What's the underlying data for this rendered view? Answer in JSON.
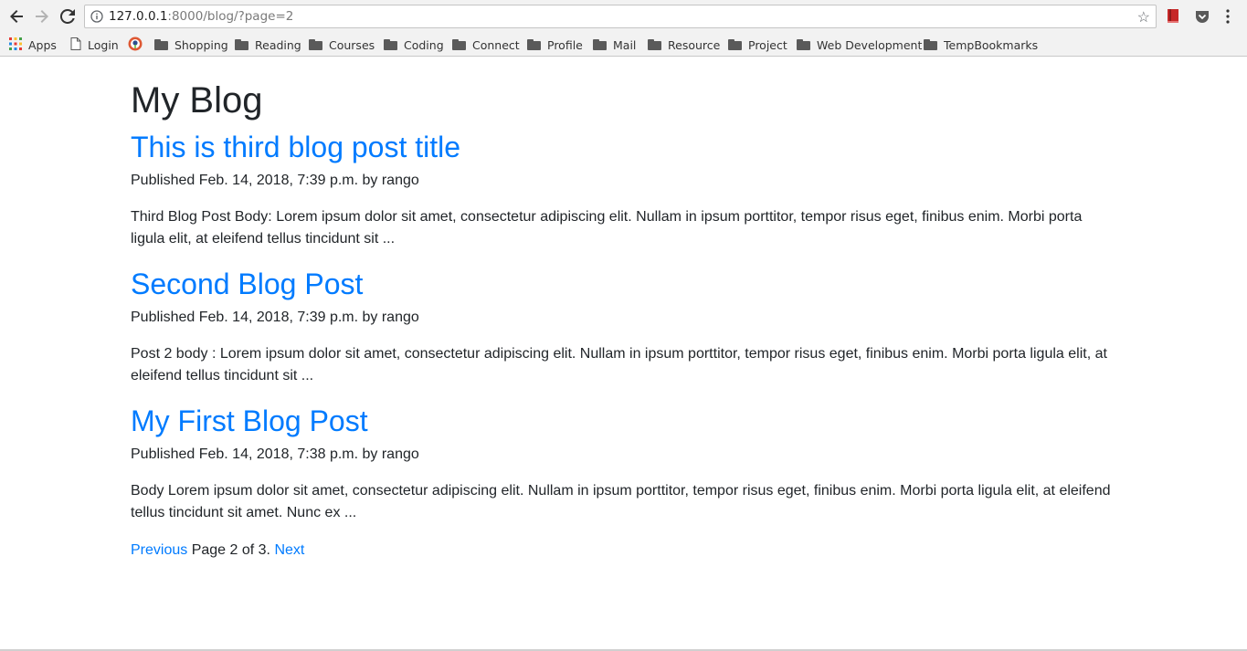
{
  "browser": {
    "url_host": "127.0.0.1",
    "url_path": ":8000/blog/?page=2",
    "bookmarks": [
      "Apps",
      "Login",
      "Shopping",
      "Reading",
      "Courses",
      "Coding",
      "Connect",
      "Profile",
      "Mail",
      "Resource",
      "Project",
      "Web Development",
      "TempBookmarks"
    ]
  },
  "page": {
    "title": "My Blog",
    "posts": [
      {
        "title": "This is third blog post title",
        "meta": "Published Feb. 14, 2018, 7:39 p.m. by rango",
        "body": "Third Blog Post Body: Lorem ipsum dolor sit amet, consectetur adipiscing elit. Nullam in ipsum porttitor, tempor risus eget, finibus enim. Morbi porta ligula elit, at eleifend tellus tincidunt sit ..."
      },
      {
        "title": "Second Blog Post",
        "meta": "Published Feb. 14, 2018, 7:39 p.m. by rango",
        "body": "Post 2 body : Lorem ipsum dolor sit amet, consectetur adipiscing elit. Nullam in ipsum porttitor, tempor risus eget, finibus enim. Morbi porta ligula elit, at eleifend tellus tincidunt sit ..."
      },
      {
        "title": "My First Blog Post",
        "meta": "Published Feb. 14, 2018, 7:38 p.m. by rango",
        "body": "Body Lorem ipsum dolor sit amet, consectetur adipiscing elit. Nullam in ipsum porttitor, tempor risus eget, finibus enim. Morbi porta ligula elit, at eleifend tellus tincidunt sit amet. Nunc ex ..."
      }
    ],
    "pagination": {
      "previous": "Previous",
      "status": " Page 2 of 3. ",
      "next": "Next"
    }
  },
  "colors": {
    "link": "#007bff",
    "text": "#212529"
  }
}
